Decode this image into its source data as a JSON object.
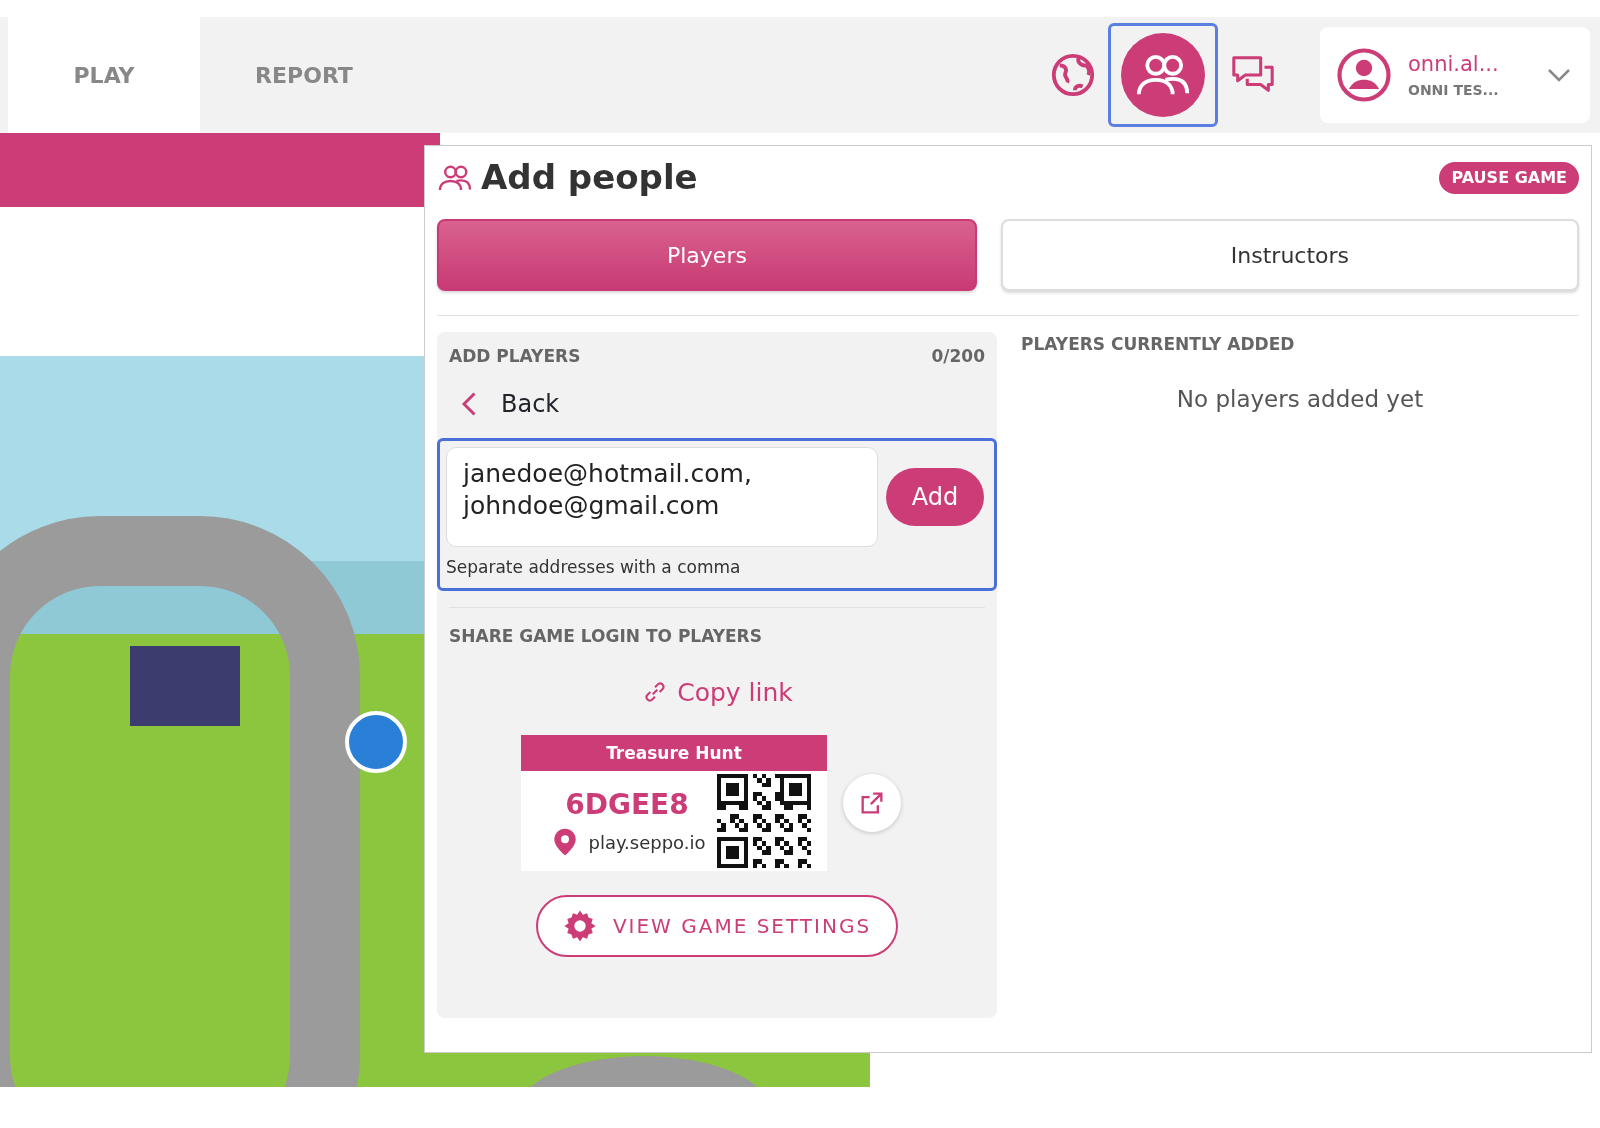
{
  "tabs": [
    {
      "label": "PLAY",
      "selected": true
    },
    {
      "label": "REPORT",
      "selected": false
    }
  ],
  "toolbar": [
    {
      "kind": "globe",
      "selected": false
    },
    {
      "kind": "people",
      "selected": true
    },
    {
      "kind": "chat",
      "selected": false
    }
  ],
  "user": {
    "name": "onni.al...",
    "org": "ONNI TES..."
  },
  "panel": {
    "title": "Add people",
    "pause_button": "PAUSE GAME",
    "tabs": [
      {
        "label": "Players",
        "selected": true
      },
      {
        "label": "Instructors",
        "selected": false
      }
    ],
    "add_players": {
      "heading": "ADD PLAYERS",
      "count": "0/200",
      "back": "Back",
      "value": "janedoe@hotmail.com, johndoe@gmail.com",
      "add_button": "Add",
      "hint": "Separate addresses with a comma"
    },
    "share": {
      "heading": "SHARE GAME LOGIN TO PLAYERS",
      "copy_link": "Copy link",
      "card_title": "Treasure Hunt",
      "code": "6DGEE8",
      "url": "play.seppo.io",
      "settings_button": "VIEW GAME SETTINGS"
    },
    "current": {
      "heading": "PLAYERS CURRENTLY ADDED",
      "empty": "No players added yet"
    }
  }
}
